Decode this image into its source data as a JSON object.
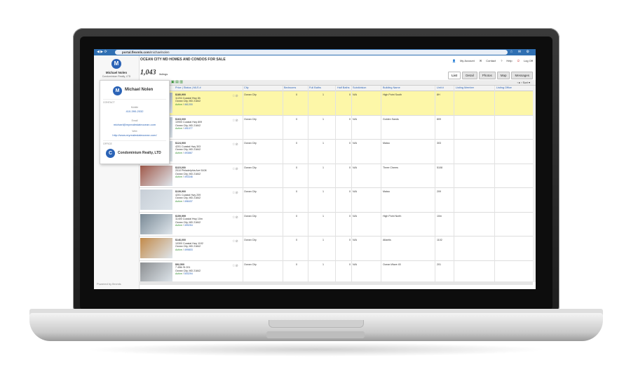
{
  "browser": {
    "url_host": "portal.flexmls.com",
    "url_path": "/michaelnolen"
  },
  "sidebar": {
    "avatar_letter": "M",
    "agent_name": "Michael Nolen",
    "agent_company": "Condominium Realty, LTD",
    "powered_by": "Powered by flexmls"
  },
  "popup": {
    "avatar_letter": "M",
    "name": "Michael Nolen",
    "contact_heading": "CONTACT",
    "phone_label": "Mobile",
    "phone": "410-390-2032",
    "email_label": "Email",
    "email": "michael@myrealestateocean.com",
    "web_label": "Web",
    "web": "http://www.myrealestateocean.com/",
    "office_heading": "OFFICE",
    "office_letter": "C",
    "office_name": "Condominium Realty, LTD"
  },
  "header": {
    "page_title": "OCEAN CITY MD HOMES AND CONDOS FOR SALE",
    "listing_count": "1,043",
    "listing_count_label": "listings"
  },
  "topnav": {
    "my_account": "My Account",
    "contact": "Contact",
    "help": "Help",
    "log_off": "Log Off"
  },
  "tabs": [
    "List",
    "Detail",
    "Photos",
    "Map",
    "Messages"
  ],
  "toolbar": {
    "sort_label": "Sort"
  },
  "columns": {
    "price_status_mls": "Price | Status | MLS #",
    "city": "City",
    "bedrooms": "Bedrooms",
    "full_baths": "Full Baths",
    "half_baths": "Half Baths",
    "subdivision": "Subdivision",
    "building_name": "Building Name",
    "unit": "Unit #",
    "listing_member": "Listing Member",
    "listing_office": "Listing Office"
  },
  "listings": [
    {
      "price": "$180,900",
      "address": "11204 Coastal Hwy 8h",
      "citystate": "Ocean City, MD 21842",
      "status": "Active",
      "mls": "461200",
      "city": "Ocean City",
      "beds": "0",
      "full": "1",
      "half": "0",
      "subdivision": "N/A",
      "building": "High Point South",
      "unit": "8H",
      "highlight": true,
      "photo_color": "#6f7f92"
    },
    {
      "price": "$163,000",
      "address": "10900 Coastal Hwy 809",
      "citystate": "Ocean City, MD 21842",
      "status": "Active",
      "mls": "491077",
      "city": "Ocean City",
      "beds": "0",
      "full": "1",
      "half": "0",
      "subdivision": "N/A",
      "building": "Golden Sands",
      "unit": "809",
      "highlight": false,
      "photo_color": "#8ba3bd"
    },
    {
      "price": "$124,900",
      "address": "4201 Coastal Hwy 303",
      "citystate": "Ocean City, MD 21842",
      "status": "Active",
      "mls": "493867",
      "city": "Ocean City",
      "beds": "0",
      "full": "1",
      "half": "0",
      "subdivision": "N/A",
      "building": "Maisa",
      "unit": "303",
      "highlight": false,
      "photo_color": "#b8c4cf"
    },
    {
      "price": "$115,000",
      "address": "2010 Philadelphia Ave 5108",
      "citystate": "Ocean City, MD 21842",
      "status": "Active",
      "mls": "493346",
      "city": "Ocean City",
      "beds": "0",
      "full": "1",
      "half": "0",
      "subdivision": "N/A",
      "building": "Three Cheers",
      "unit": "5108",
      "highlight": false,
      "photo_color": "#a0594a"
    },
    {
      "price": "$139,900",
      "address": "4201 Coastal Hwy 209",
      "citystate": "Ocean City, MD 21842",
      "status": "Active",
      "mls": "498437",
      "city": "Ocean City",
      "beds": "0",
      "full": "1",
      "half": "0",
      "subdivision": "N/A",
      "building": "Maisa",
      "unit": "209",
      "highlight": false,
      "photo_color": "#c7ced6"
    },
    {
      "price": "$159,999",
      "address": "11400 Coastal Hwy 10m",
      "citystate": "Ocean City, MD 21842",
      "status": "Active",
      "mls": "499254",
      "city": "Ocean City",
      "beds": "0",
      "full": "1",
      "half": "0",
      "subdivision": "N/A",
      "building": "High Point North",
      "unit": "10m",
      "highlight": false,
      "photo_color": "#7a8a96"
    },
    {
      "price": "$146,000",
      "address": "10300 Coastal Hwy 1102",
      "citystate": "Ocean City, MD 21842",
      "status": "Active",
      "mls": "499803",
      "city": "Ocean City",
      "beds": "0",
      "full": "1",
      "half": "0",
      "subdivision": "N/A",
      "building": "Atlantis",
      "unit": "1102",
      "highlight": false,
      "photo_color": "#c28a4a"
    },
    {
      "price": "$92,500",
      "address": "7 45th St 201",
      "citystate": "Ocean City, MD 21842",
      "status": "Active",
      "mls": "500294",
      "city": "Ocean City",
      "beds": "0",
      "full": "1",
      "half": "0",
      "subdivision": "N/A",
      "building": "Ocean Wave 45",
      "unit": "201",
      "highlight": false,
      "photo_color": "#8c8f92"
    }
  ]
}
